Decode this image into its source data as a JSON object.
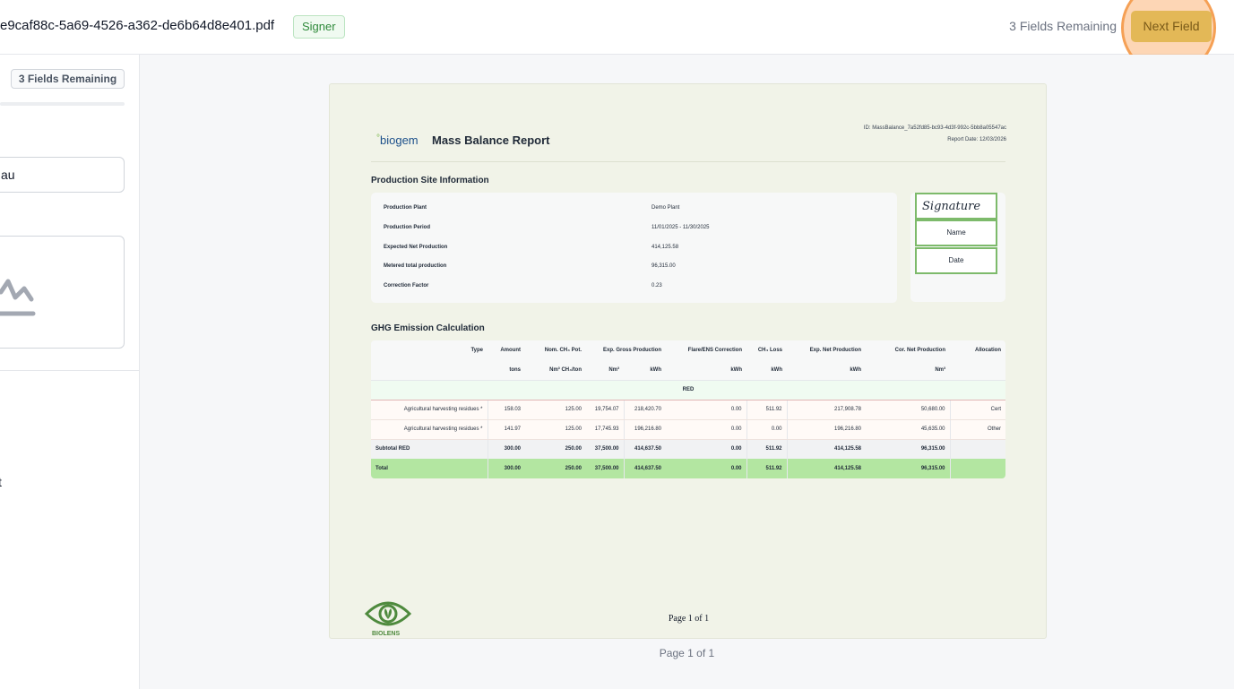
{
  "header": {
    "filename": "e9caf88c-5a69-4526-a362-de6b64d8e401.pdf",
    "role_badge": "Signer",
    "fields_remaining": "3 Fields Remaining",
    "next_field_label": "Next Field"
  },
  "sidebar": {
    "fields_remaining": "3 Fields Remaining",
    "input_value": "au",
    "truncated_text": "t"
  },
  "document": {
    "logo_text": "biogem",
    "title": "Mass Balance Report",
    "id_line": "ID: MassBalance_7a52fd85-bc93-4d3f-992c-5bb8a05547ac",
    "report_date": "Report Date: 12/03/2026",
    "site_section_title": "Production Site Information",
    "site_info": [
      {
        "label": "Production Plant",
        "value": "Demo Plant"
      },
      {
        "label": "Production Period",
        "value": "11/01/2025 - 11/30/2025"
      },
      {
        "label": "Expected Net Production",
        "value": "414,125.58"
      },
      {
        "label": "Metered total production",
        "value": "96,315.00"
      },
      {
        "label": "Correction Factor",
        "value": "0.23"
      }
    ],
    "signature_fields": {
      "signature": "Signature",
      "name": "Name",
      "date": "Date"
    },
    "ghg_section_title": "GHG Emission Calculation",
    "ghg_headers": [
      "Type",
      "Amount",
      "Nom. CH₄ Pot.",
      "Exp. Gross Production",
      "",
      "Flare/ENS Correction",
      "CH₄ Loss",
      "Exp. Net Production",
      "Cor. Net Production",
      "Allocation"
    ],
    "ghg_units": [
      "",
      "tons",
      "Nm³ CH₄/ton",
      "Nm³",
      "kWh",
      "kWh",
      "kWh",
      "kWh",
      "Nm³",
      ""
    ],
    "ghg_group": "RED",
    "ghg_rows": [
      [
        "Agricultural harvesting residues *",
        "158.03",
        "125.00",
        "19,754.07",
        "218,420.70",
        "0.00",
        "511.92",
        "217,908.78",
        "50,680.00",
        "Cert"
      ],
      [
        "Agricultural harvesting residues *",
        "141.97",
        "125.00",
        "17,745.93",
        "196,216.80",
        "0.00",
        "0.00",
        "196,216.80",
        "45,635.00",
        "Other"
      ]
    ],
    "ghg_subtotal": [
      "Subtotal RED",
      "300.00",
      "250.00",
      "37,500.00",
      "414,637.50",
      "0.00",
      "511.92",
      "414,125.58",
      "96,315.00",
      ""
    ],
    "ghg_total": [
      "Total",
      "300.00",
      "250.00",
      "37,500.00",
      "414,637.50",
      "0.00",
      "511.92",
      "414,125.58",
      "96,315.00",
      ""
    ],
    "bottom_logo_text": "BIOLENS",
    "page_number": "Page 1 of 1"
  },
  "page_caption": "Page 1 of 1",
  "colors": {
    "accent_green": "#2f8a3b",
    "next_button": "#e3b857",
    "highlight_ring": "#f5a055",
    "total_row": "#b3e6a1",
    "field_border": "#7dba6b"
  }
}
